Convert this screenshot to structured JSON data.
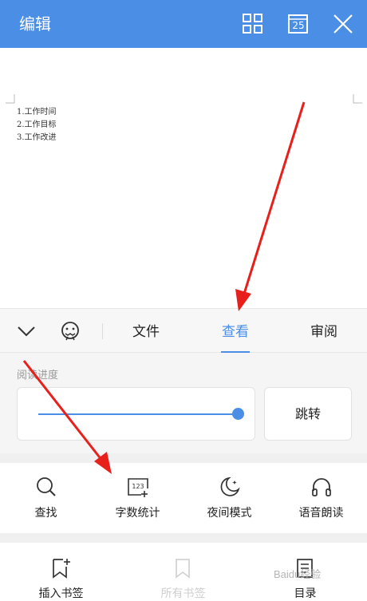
{
  "header": {
    "title": "编辑",
    "page_number": "25"
  },
  "document": {
    "lines": [
      "1.工作时间",
      "2.工作目标",
      "3.工作改进"
    ]
  },
  "tabs": {
    "items": [
      "文件",
      "查看",
      "审阅"
    ],
    "active": "查看"
  },
  "progress": {
    "label": "阅读进度",
    "value": 1.0,
    "jump_label": "跳转"
  },
  "tools": [
    "查找",
    "字数统计",
    "夜间模式",
    "语音朗读"
  ],
  "bottom": [
    {
      "label": "插入书签",
      "enabled": true
    },
    {
      "label": "所有书签",
      "enabled": false
    },
    {
      "label": "目录",
      "enabled": true
    }
  ],
  "colors": {
    "accent": "#4a8ee6",
    "annotation_arrow": "#e8201c"
  },
  "watermark": "Baidu经验"
}
